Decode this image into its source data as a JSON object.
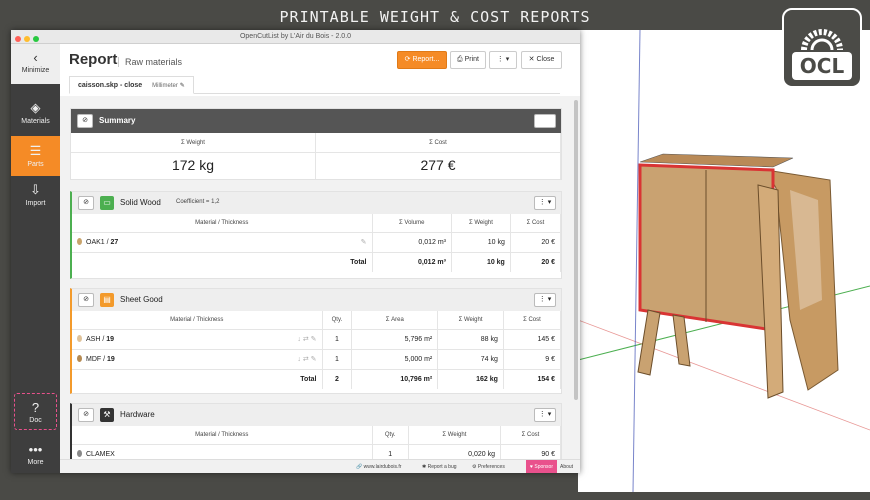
{
  "banner": "PRINTABLE WEIGHT & COST REPORTS",
  "logo_text": "OCL",
  "window_title": "OpenCutList by L'Air du Bois - 2.0.0",
  "sidebar": {
    "minimize": "Minimize",
    "items": [
      {
        "label": "Materials",
        "icon": "materials-icon"
      },
      {
        "label": "Parts",
        "icon": "parts-icon"
      },
      {
        "label": "Import",
        "icon": "import-icon"
      }
    ],
    "doc": "Doc",
    "more": "More"
  },
  "header": {
    "title": "Report",
    "subtitle": "Raw materials",
    "report_btn": "Report...",
    "print_btn": "Print",
    "close_btn": "Close"
  },
  "tab": {
    "file": "caisson.skp - close",
    "unit": "Millimeter"
  },
  "summary": {
    "title": "Summary",
    "weight_label": "Σ Weight",
    "cost_label": "Σ Cost",
    "weight": "172 kg",
    "cost": "277 €"
  },
  "solid_wood": {
    "title": "Solid Wood",
    "coefficient": "Coefficient = 1,2",
    "headers": [
      "Material / Thickness",
      "Σ Volume",
      "Σ Weight",
      "Σ Cost"
    ],
    "rows": [
      {
        "material": "OAK1",
        "thickness": "27",
        "volume": "0,012 m³",
        "weight": "10 kg",
        "cost": "20 €"
      }
    ],
    "total": {
      "label": "Total",
      "volume": "0,012 m³",
      "weight": "10 kg",
      "cost": "20 €"
    }
  },
  "sheet_good": {
    "title": "Sheet Good",
    "headers": [
      "Material / Thickness",
      "Qty.",
      "Σ Area",
      "Σ Weight",
      "Σ Cost"
    ],
    "rows": [
      {
        "material": "ASH",
        "thickness": "19",
        "qty": "1",
        "area": "5,796 m²",
        "weight": "88 kg",
        "cost": "145 €"
      },
      {
        "material": "MDF",
        "thickness": "19",
        "qty": "1",
        "area": "5,000 m²",
        "weight": "74 kg",
        "cost": "9 €"
      }
    ],
    "total": {
      "label": "Total",
      "qty": "2",
      "area": "10,796 m²",
      "weight": "162 kg",
      "cost": "154 €"
    }
  },
  "hardware": {
    "title": "Hardware",
    "headers": [
      "Material / Thickness",
      "Qty.",
      "Σ Weight",
      "Σ Cost"
    ],
    "rows": [
      {
        "material": "CLAMEX",
        "qty": "1",
        "weight": "0,020 kg",
        "cost": "90 €"
      }
    ]
  },
  "footer": {
    "site": "www.lairdubois.fr",
    "bug": "Report a bug",
    "prefs": "Preferences",
    "sponsor": "Sponsor",
    "about": "About"
  },
  "colors": {
    "accent": "#f58b26",
    "sponsor": "#e9518c",
    "solid_wood": "#4caf50",
    "sheet_good": "#f39a2b",
    "hardware": "#333333"
  }
}
